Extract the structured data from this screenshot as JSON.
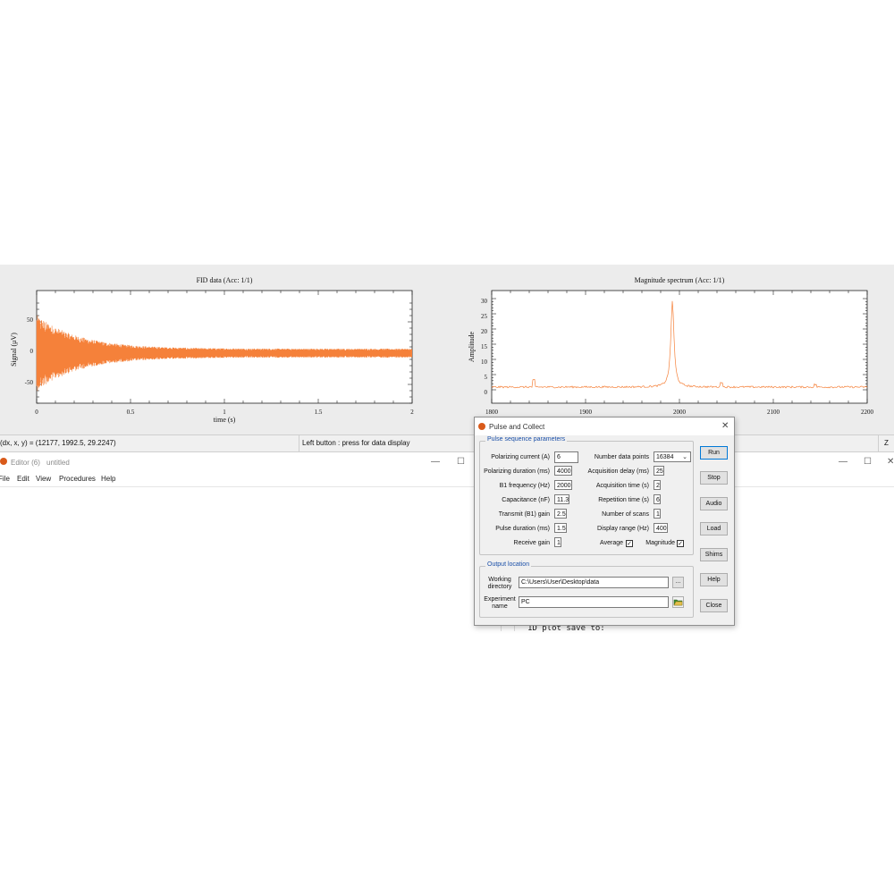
{
  "fid_plot": {
    "title": "FID data (Acc: 1/1)",
    "xlabel": "time (s)",
    "ylabel": "Signal (μV)",
    "xticks": [
      "0",
      "0.5",
      "1",
      "1.5",
      "2"
    ],
    "yticks": [
      "50",
      "0",
      "-50"
    ]
  },
  "spectrum_plot": {
    "title": "Magnitude spectrum (Acc: 1/1)",
    "ylabel": "Amplitude",
    "xticks": [
      "1800",
      "1900",
      "2000",
      "2100",
      "2200"
    ],
    "yticks": [
      "30",
      "25",
      "20",
      "15",
      "10",
      "5",
      "0"
    ]
  },
  "statusbar": {
    "coords": "(dx, x, y) = (12177, 1992.5,  29.2247)",
    "hint": "Left button : press for data display",
    "right": "Z"
  },
  "editor": {
    "title_app": "Editor (6)",
    "title_file": "untitled",
    "menu": [
      "File",
      "Edit",
      "View",
      "Procedures",
      "Help"
    ],
    "code_line": "1D plot save to:"
  },
  "dialog": {
    "title": "Pulse and Collect",
    "group_params": "Pulse sequence parameters",
    "left_fields": [
      {
        "label": "Polarizing current (A)",
        "value": "6"
      },
      {
        "label": "Polarizing duration (ms)",
        "value": "4000"
      },
      {
        "label": "B1 frequency (Hz)",
        "value": "2000"
      },
      {
        "label": "Capacitance (nF)",
        "value": "11.3"
      },
      {
        "label": "Transmit (B1) gain",
        "value": "2.5"
      },
      {
        "label": "Pulse duration (ms)",
        "value": "1.5"
      },
      {
        "label": "Receive gain",
        "value": "1"
      }
    ],
    "right_fields": [
      {
        "label": "Number data points",
        "value": "16384"
      },
      {
        "label": "Acquisition delay (ms)",
        "value": "25"
      },
      {
        "label": "Acquisition time (s)",
        "value": "2"
      },
      {
        "label": "Repetition time (s)",
        "value": "6"
      },
      {
        "label": "Number of scans",
        "value": "1"
      },
      {
        "label": "Display range (Hz)",
        "value": "400"
      }
    ],
    "average_label": "Average",
    "magnitude_label": "Magnitude",
    "group_output": "Output location",
    "working_dir_label": "Working directory",
    "working_dir_value": "C:\\Users\\User\\Desktop\\data",
    "experiment_label": "Experiment name",
    "experiment_value": "PC",
    "browse_label": "...",
    "buttons": [
      "Run",
      "Stop",
      "Audio",
      "Load",
      "Shims",
      "Help",
      "Close"
    ]
  },
  "colors": {
    "signal": "#f5813a",
    "accent": "#1a4fa8"
  }
}
